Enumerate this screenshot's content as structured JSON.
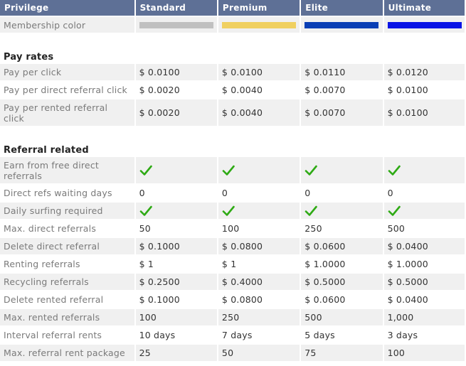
{
  "header": {
    "privilege": "Privilege",
    "plans": [
      "Standard",
      "Premium",
      "Elite",
      "Ultimate"
    ]
  },
  "membership_color": {
    "label": "Membership color",
    "colors": [
      "#c0c0c0",
      "#f0d060",
      "#0a3fb5",
      "#0a14e6"
    ]
  },
  "pay_rates": {
    "title": "Pay rates",
    "rows": [
      {
        "label": "Pay per click",
        "values": [
          "$ 0.0100",
          "$ 0.0100",
          "$ 0.0110",
          "$ 0.0120"
        ]
      },
      {
        "label": "Pay per direct referral click",
        "values": [
          "$ 0.0020",
          "$ 0.0040",
          "$ 0.0070",
          "$ 0.0100"
        ]
      },
      {
        "label": "Pay per rented referral click",
        "values": [
          "$ 0.0020",
          "$ 0.0040",
          "$ 0.0070",
          "$ 0.0100"
        ]
      }
    ]
  },
  "referral_related": {
    "title": "Referral related",
    "rows": [
      {
        "label": "Earn from free direct referrals",
        "check": true
      },
      {
        "label": "Direct refs waiting days",
        "values": [
          "0",
          "0",
          "0",
          "0"
        ]
      },
      {
        "label": "Daily surfing required",
        "check": true
      },
      {
        "label": "Max. direct referrals",
        "values": [
          "50",
          "100",
          "250",
          "500"
        ]
      },
      {
        "label": "Delete direct referral",
        "values": [
          "$ 0.1000",
          "$ 0.0800",
          "$ 0.0600",
          "$ 0.0400"
        ]
      },
      {
        "label": "Renting referrals",
        "values": [
          "$ 1",
          "$ 1",
          "$ 1.0000",
          "$ 1.0000"
        ]
      },
      {
        "label": "Recycling referrals",
        "values": [
          "$ 0.2500",
          "$ 0.4000",
          "$ 0.5000",
          "$ 0.5000"
        ]
      },
      {
        "label": "Delete rented referral",
        "values": [
          "$ 0.1000",
          "$ 0.0800",
          "$ 0.0600",
          "$ 0.0400"
        ]
      },
      {
        "label": "Max. rented referrals",
        "values": [
          "100",
          "250",
          "500",
          "1,000"
        ]
      },
      {
        "label": "Interval referral rents",
        "values": [
          "10 days",
          "7 days",
          "5 days",
          "3 days"
        ]
      },
      {
        "label": "Max. referral rent package",
        "values": [
          "25",
          "50",
          "75",
          "100"
        ]
      }
    ]
  },
  "icons": {
    "check": "checkmark-icon",
    "check_color": "#2eaa14"
  }
}
